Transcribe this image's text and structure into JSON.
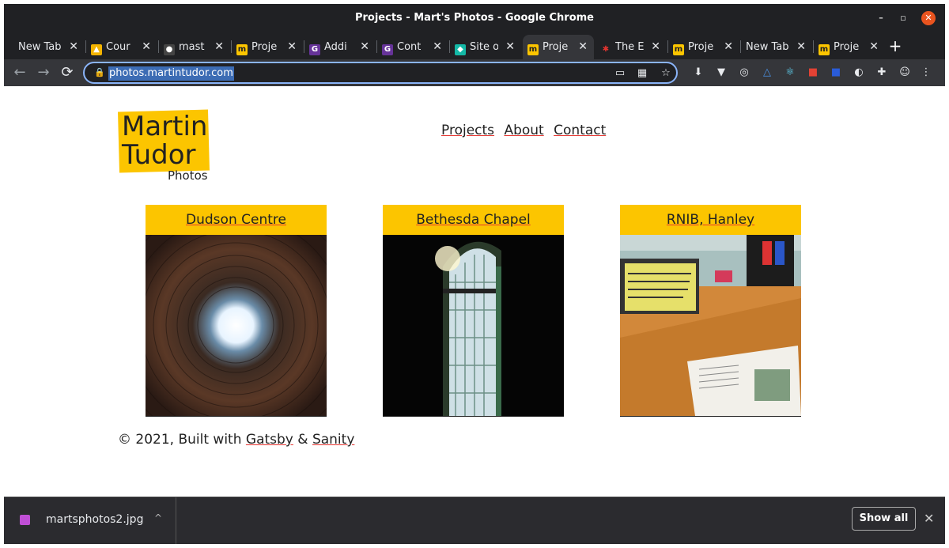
{
  "window": {
    "title": "Projects - Mart's Photos - Google Chrome",
    "min": "–",
    "max": "▫",
    "close": "✕"
  },
  "tabs": [
    {
      "label": "New Tab",
      "fav": "",
      "favcolor": "transparent"
    },
    {
      "label": "Cour",
      "fav": "▲",
      "favcolor": "#f4b400"
    },
    {
      "label": "mast",
      "fav": "●",
      "favcolor": "#444"
    },
    {
      "label": "Proje",
      "fav": "m",
      "favcolor": "#fcc500"
    },
    {
      "label": "Addi",
      "fav": "G",
      "favcolor": "#663399"
    },
    {
      "label": "Cont",
      "fav": "G",
      "favcolor": "#663399"
    },
    {
      "label": "Site o",
      "fav": "◆",
      "favcolor": "#14b8a6"
    },
    {
      "label": "Proje",
      "fav": "m",
      "favcolor": "#fcc500"
    },
    {
      "label": "The E",
      "fav": "✱",
      "favcolor": "transparent"
    },
    {
      "label": "Proje",
      "fav": "m",
      "favcolor": "#fcc500"
    },
    {
      "label": "New Tab",
      "fav": "",
      "favcolor": "transparent"
    },
    {
      "label": "Proje",
      "fav": "m",
      "favcolor": "#fcc500"
    }
  ],
  "tab_close": "✕",
  "newtab": "+",
  "toolbar": {
    "back": "←",
    "forward": "→",
    "reload": "⟳",
    "lock": "🔒",
    "url": "photos.martintudor.com",
    "cast": "▭",
    "apps": "▦",
    "star": "☆",
    "menu": "⋮"
  },
  "extensions": [
    "⬇",
    "▼",
    "◎",
    "△",
    "⚛",
    "■",
    "■",
    "◐",
    "✚",
    "☺"
  ],
  "site": {
    "logo_line1": "Martin",
    "logo_line2": "Tudor",
    "logo_sub": "Photos",
    "nav": [
      "Projects",
      "About",
      "Contact"
    ],
    "cards": [
      {
        "title": "Dudson Centre"
      },
      {
        "title": "Bethesda Chapel"
      },
      {
        "title": "RNIB, Hanley"
      }
    ],
    "footer_prefix": "© 2021, Built with ",
    "footer_link1": "Gatsby",
    "footer_amp": " & ",
    "footer_link2": "Sanity"
  },
  "downloads": {
    "filename": "martsphotos2.jpg",
    "caret": "^",
    "show_all": "Show all",
    "close": "✕"
  },
  "colors": {
    "accent": "#fcc500",
    "underline": "#e5342f"
  }
}
